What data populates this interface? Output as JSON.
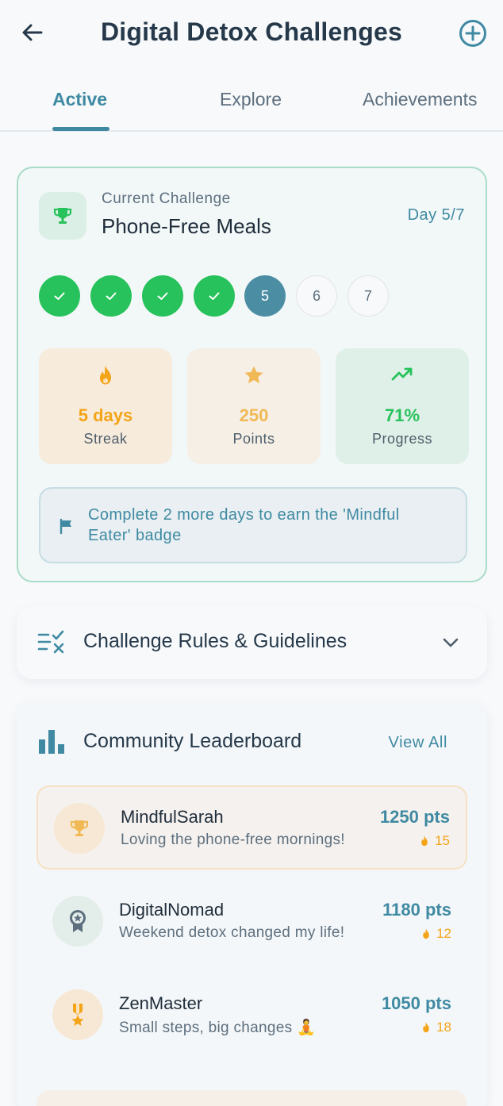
{
  "header": {
    "title": "Digital Detox Challenges"
  },
  "tabs": [
    {
      "label": "Active",
      "active": true
    },
    {
      "label": "Explore",
      "active": false
    },
    {
      "label": "Achievements",
      "active": false
    }
  ],
  "current_challenge": {
    "label": "Current Challenge",
    "name": "Phone-Free Meals",
    "day_text": "Day 5/7",
    "days": [
      {
        "n": "1",
        "state": "done"
      },
      {
        "n": "2",
        "state": "done"
      },
      {
        "n": "3",
        "state": "done"
      },
      {
        "n": "4",
        "state": "done"
      },
      {
        "n": "5",
        "state": "current"
      },
      {
        "n": "6",
        "state": "future"
      },
      {
        "n": "7",
        "state": "future"
      }
    ],
    "stats": {
      "streak": {
        "value": "5 days",
        "label": "Streak",
        "color": "#f4a417"
      },
      "points": {
        "value": "250",
        "label": "Points",
        "color": "#f0b955"
      },
      "progress": {
        "value": "71%",
        "label": "Progress",
        "color": "#27c25b"
      }
    },
    "hint": "Complete 2 more days to earn the 'Mindful Eater' badge"
  },
  "rules": {
    "title": "Challenge Rules & Guidelines"
  },
  "leaderboard": {
    "title": "Community Leaderboard",
    "view_all": "View All",
    "entries": [
      {
        "name": "MindfulSarah",
        "message": "Loving the phone-free mornings!",
        "points": "1250 pts",
        "streak": "15"
      },
      {
        "name": "DigitalNomad",
        "message": "Weekend detox changed my life!",
        "points": "1180 pts",
        "streak": "12"
      },
      {
        "name": "ZenMaster",
        "message": "Small steps, big changes 🧘",
        "points": "1050 pts",
        "streak": "18"
      }
    ]
  },
  "colors": {
    "accent": "#3f8aa2",
    "success": "#27c25b",
    "warning": "#f4a417",
    "background": "#f7f9fb"
  }
}
